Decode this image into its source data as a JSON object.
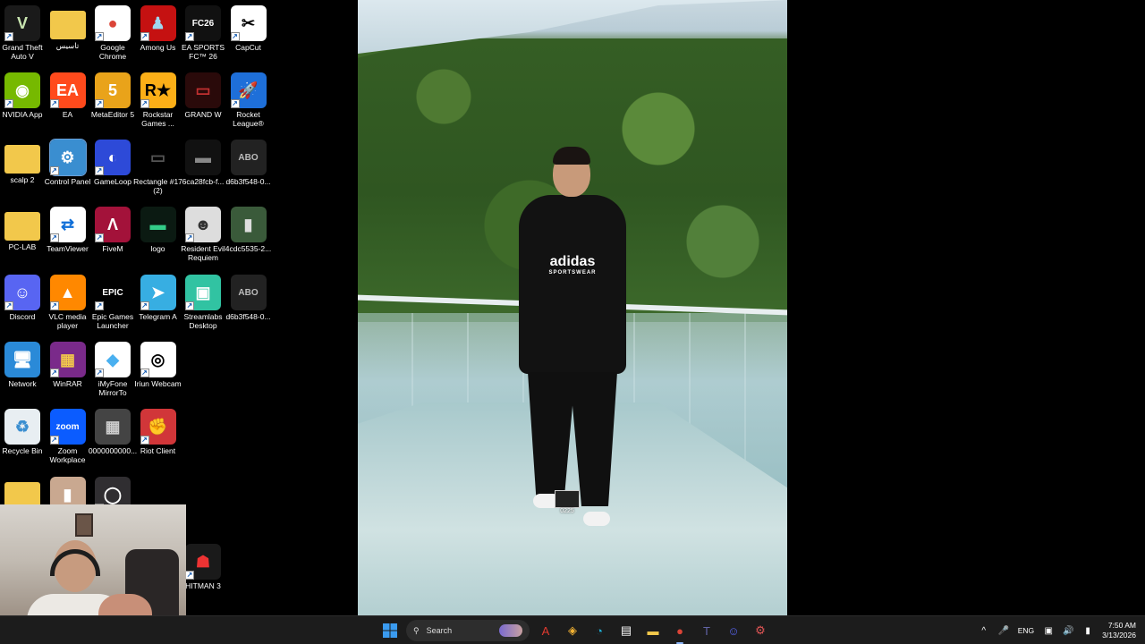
{
  "desktop_icons": [
    {
      "id": "gta5",
      "label": "Grand Theft Auto V",
      "glyph": "V",
      "color": "#1a1a1a",
      "fg": "#c9e5b0",
      "shortcut": true
    },
    {
      "id": "folder-arabic",
      "label": "تاسيس",
      "glyph": "",
      "color": "#f2c84b",
      "fg": "#fff",
      "shortcut": false
    },
    {
      "id": "chrome",
      "label": "Google Chrome",
      "glyph": "●",
      "color": "#ffffff",
      "fg": "#db4437",
      "shortcut": true
    },
    {
      "id": "among-us",
      "label": "Among Us",
      "glyph": "♟",
      "color": "#c51111",
      "fg": "#9fd8f0",
      "shortcut": true
    },
    {
      "id": "ea-fc",
      "label": "EA SPORTS FC™ 26",
      "glyph": "FC26",
      "color": "#111111",
      "fg": "#fff",
      "shortcut": true
    },
    {
      "id": "capcut",
      "label": "CapCut",
      "glyph": "✂",
      "color": "#ffffff",
      "fg": "#000",
      "shortcut": true
    },
    {
      "id": "nvidia",
      "label": "NVIDIA App",
      "glyph": "◉",
      "color": "#76b900",
      "fg": "#fff",
      "shortcut": true
    },
    {
      "id": "ea",
      "label": "EA",
      "glyph": "EA",
      "color": "#ff4a1c",
      "fg": "#fff",
      "shortcut": true
    },
    {
      "id": "metaeditor",
      "label": "MetaEditor 5",
      "glyph": "5",
      "color": "#e9a31a",
      "fg": "#fff",
      "shortcut": true
    },
    {
      "id": "rockstar",
      "label": "Rockstar Games ...",
      "glyph": "R★",
      "color": "#fcaf17",
      "fg": "#000",
      "shortcut": true
    },
    {
      "id": "grand-w",
      "label": "GRAND W",
      "glyph": "▭",
      "color": "#2a0a0a",
      "fg": "#c03030",
      "shortcut": false
    },
    {
      "id": "rocket-league",
      "label": "Rocket League®",
      "glyph": "🚀",
      "color": "#1e6fd9",
      "fg": "#fff",
      "shortcut": true
    },
    {
      "id": "scalp2",
      "label": "scalp 2",
      "glyph": "",
      "color": "#f2c84b",
      "fg": "#fff",
      "shortcut": false
    },
    {
      "id": "control-panel",
      "label": "Control Panel",
      "glyph": "⚙",
      "color": "#3a8ed0",
      "fg": "#fff",
      "shortcut": true,
      "selected": true
    },
    {
      "id": "gameloop",
      "label": "GameLoop",
      "glyph": "◐",
      "color": "#2d4ad8",
      "fg": "#fff",
      "shortcut": true
    },
    {
      "id": "rectangle",
      "label": "Rectangle #17 (2)",
      "glyph": "▭",
      "color": "#000000",
      "fg": "#555",
      "shortcut": false
    },
    {
      "id": "img-6ca",
      "label": "6ca28fcb-f...",
      "glyph": "▬",
      "color": "#111",
      "fg": "#888",
      "shortcut": false
    },
    {
      "id": "img-d6b-1",
      "label": "d6b3f548-0...",
      "glyph": "ABO",
      "color": "#222",
      "fg": "#bbb",
      "shortcut": false
    },
    {
      "id": "pc-lab",
      "label": "PC-LAB",
      "glyph": "",
      "color": "#f2c84b",
      "fg": "#fff",
      "shortcut": false
    },
    {
      "id": "teamviewer",
      "label": "TeamViewer",
      "glyph": "⇄",
      "color": "#ffffff",
      "fg": "#0e6ed8",
      "shortcut": true
    },
    {
      "id": "fivem",
      "label": "FiveM",
      "glyph": "Λ",
      "color": "#a3123a",
      "fg": "#fff",
      "shortcut": true
    },
    {
      "id": "logo",
      "label": "logo",
      "glyph": "▬",
      "color": "#0b1a12",
      "fg": "#3c8",
      "shortcut": false
    },
    {
      "id": "resident-evil",
      "label": "Resident Evil Requiem",
      "glyph": "☻",
      "color": "#dddddd",
      "fg": "#333",
      "shortcut": true
    },
    {
      "id": "img-4cdc",
      "label": "4cdc5535-2...",
      "glyph": "▮",
      "color": "#3a5a3a",
      "fg": "#ddd",
      "shortcut": false
    },
    {
      "id": "discord",
      "label": "Discord",
      "glyph": "☺",
      "color": "#5865f2",
      "fg": "#fff",
      "shortcut": true
    },
    {
      "id": "vlc",
      "label": "VLC media player",
      "glyph": "▲",
      "color": "#ff8800",
      "fg": "#fff",
      "shortcut": true
    },
    {
      "id": "epic",
      "label": "Epic Games Launcher",
      "glyph": "EPIC",
      "color": "#000000",
      "fg": "#fff",
      "shortcut": true
    },
    {
      "id": "telegram",
      "label": "Telegram A",
      "glyph": "➤",
      "color": "#37aee2",
      "fg": "#fff",
      "shortcut": true
    },
    {
      "id": "streamlabs",
      "label": "Streamlabs Desktop",
      "glyph": "▣",
      "color": "#31c3a2",
      "fg": "#fff",
      "shortcut": true
    },
    {
      "id": "img-d6b-2",
      "label": "d6b3f548-0...",
      "glyph": "ABO",
      "color": "#222",
      "fg": "#bbb",
      "shortcut": false
    },
    {
      "id": "network",
      "label": "Network",
      "glyph": "🖥",
      "color": "#2a8ad8",
      "fg": "#fff",
      "shortcut": false
    },
    {
      "id": "winrar",
      "label": "WinRAR",
      "glyph": "▦",
      "color": "#7a2a8a",
      "fg": "#f2c84b",
      "shortcut": true
    },
    {
      "id": "mirrorto",
      "label": "iMyFone MirrorTo",
      "glyph": "◆",
      "color": "#ffffff",
      "fg": "#4ab0f0",
      "shortcut": true
    },
    {
      "id": "iriun",
      "label": "Iriun Webcam",
      "glyph": "◎",
      "color": "#ffffff",
      "fg": "#000",
      "shortcut": true
    },
    {
      "id": "recycle-bin",
      "label": "Recycle Bin",
      "glyph": "♻",
      "color": "#e8eef2",
      "fg": "#3a8ed0",
      "shortcut": false
    },
    {
      "id": "zoom",
      "label": "Zoom Workplace",
      "glyph": "zoom",
      "color": "#0b5cff",
      "fg": "#fff",
      "shortcut": true
    },
    {
      "id": "img-0000",
      "label": "0000000000...",
      "glyph": "▦",
      "color": "#444",
      "fg": "#ccc",
      "shortcut": false
    },
    {
      "id": "riot",
      "label": "Riot Client",
      "glyph": "✊",
      "color": "#d13639",
      "fg": "#fff",
      "shortcut": true
    },
    {
      "id": "folder-bottom",
      "label": "",
      "glyph": "",
      "color": "#f2c84b",
      "fg": "#fff",
      "shortcut": false
    },
    {
      "id": "img-bottom",
      "label": "",
      "glyph": "▮",
      "color": "#c9a890",
      "fg": "#fff",
      "shortcut": false
    },
    {
      "id": "obs",
      "label": "",
      "glyph": "◯",
      "color": "#302e31",
      "fg": "#fff",
      "shortcut": true
    },
    {
      "id": "hitman3",
      "label": "HITMAN 3",
      "glyph": "☗",
      "color": "#1a1a1a",
      "fg": "#e33",
      "shortcut": true
    }
  ],
  "wallpaper_photo": {
    "shirt_brand": "adidas",
    "shirt_sub": "SPORTSWEAR",
    "file_label": "0225"
  },
  "taskbar": {
    "start_icon": "windows-logo-icon",
    "search_label": "Search",
    "pinned": [
      {
        "id": "adobe-acrobat",
        "glyph": "A",
        "color": "#e03a2f"
      },
      {
        "id": "copilot",
        "glyph": "◈",
        "color": "#f2b233"
      },
      {
        "id": "edge",
        "glyph": "◔",
        "color": "#1fb0d8"
      },
      {
        "id": "notepad",
        "glyph": "▤",
        "color": "#ffffff"
      },
      {
        "id": "file-explorer",
        "glyph": "▬",
        "color": "#f2c84b"
      },
      {
        "id": "chrome",
        "glyph": "●",
        "color": "#db4437",
        "active": true
      },
      {
        "id": "teams",
        "glyph": "T",
        "color": "#6264a7"
      },
      {
        "id": "discord",
        "glyph": "☺",
        "color": "#5865f2"
      },
      {
        "id": "settings",
        "glyph": "⚙",
        "color": "#e05555"
      }
    ],
    "tray": {
      "chevron": "^",
      "language": "ENG",
      "time": "7:50 AM",
      "date": "3/13/2026"
    }
  }
}
